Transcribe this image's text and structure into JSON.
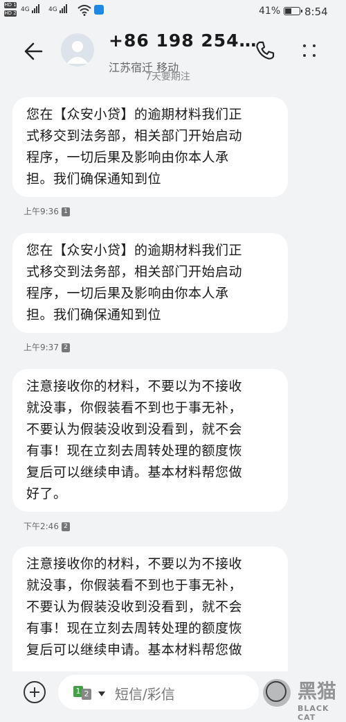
{
  "status_bar": {
    "sim1": "HD 1",
    "sim2": "HD 2",
    "net1": "4G",
    "net2": "4G",
    "battery": "41%",
    "time": "8:54"
  },
  "header": {
    "contact": "+86 198 254…",
    "location": "江苏宿迁 移动"
  },
  "scrolled_hint": "7天要期注",
  "messages": [
    {
      "lines": [
        "您在【众安小贷】的逾期材料我们正",
        "式移交到法务部，相关部门开始启动",
        "程序，一切后果及影响由你本人承",
        "担。我们确保通知到位"
      ],
      "time": "上午9:36",
      "sim": "1"
    },
    {
      "lines": [
        "您在【众安小贷】的逾期材料我们正",
        "式移交到法务部，相关部门开始启动",
        "程序，一切后果及影响由你本人承",
        "担。我们确保通知到位"
      ],
      "time": "上午9:37",
      "sim": "2"
    },
    {
      "lines": [
        "注意接收你的材料，不要以为不接收",
        "就没事，你假装看不到也于事无补，",
        "不要认为假装没收到没看到，就不会",
        "有事！现在立刻去周转处理的额度恢",
        "复后可以继续申请。基本材料帮您做",
        "好了。"
      ],
      "time": "下午2:46",
      "sim": "2"
    },
    {
      "lines": [
        "注意接收你的材料，不要以为不接收",
        "就没事，你假装看不到也于事无补，",
        "不要认为假装没收到没看到，就不会",
        "有事！现在立刻去周转处理的额度恢",
        "复后可以继续申请。基本材料帮您做"
      ],
      "time": "",
      "sim": ""
    }
  ],
  "compose": {
    "sim1": "1",
    "sim2": "2",
    "placeholder": "短信/彩信"
  },
  "watermark": {
    "cn": "黑猫",
    "en": "BLACK CAT"
  },
  "colors": {
    "background": "#f1f3f5",
    "bubble": "#ffffff",
    "text": "#1a1a1a"
  }
}
